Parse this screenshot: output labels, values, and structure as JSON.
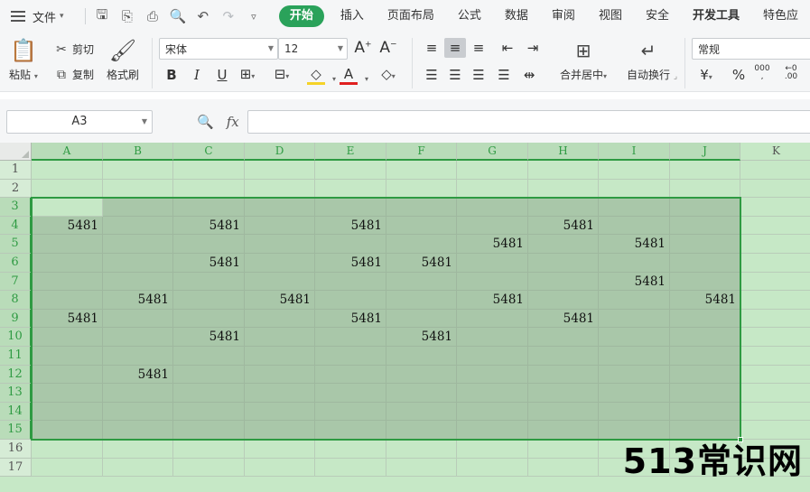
{
  "menubar": {
    "file_label": "文件",
    "tabs": [
      "开始",
      "插入",
      "页面布局",
      "公式",
      "数据",
      "审阅",
      "视图",
      "安全",
      "开发工具",
      "特色应"
    ],
    "active_tab": "开始"
  },
  "ribbon": {
    "paste_label": "粘贴",
    "cut_label": "剪切",
    "copy_label": "复制",
    "format_painter_label": "格式刷",
    "font_name": "宋体",
    "font_size": "12",
    "merge_center_label": "合并居中",
    "wrap_text_label": "自动换行",
    "number_format": "常规"
  },
  "formula_bar": {
    "name_box": "A3",
    "fx_label": "fx",
    "formula": ""
  },
  "sheet": {
    "columns": [
      "A",
      "B",
      "C",
      "D",
      "E",
      "F",
      "G",
      "H",
      "I",
      "J",
      "K"
    ],
    "rows": [
      "1",
      "2",
      "3",
      "4",
      "5",
      "6",
      "7",
      "8",
      "9",
      "10",
      "11",
      "12",
      "13",
      "14",
      "15",
      "16",
      "17"
    ],
    "cells": {
      "4": {
        "A": "5481",
        "C": "5481",
        "E": "5481",
        "H": "5481"
      },
      "5": {
        "G": "5481",
        "I": "5481"
      },
      "6": {
        "C": "5481",
        "E": "5481",
        "F": "5481"
      },
      "7": {
        "I": "5481"
      },
      "8": {
        "B": "5481",
        "D": "5481",
        "G": "5481",
        "J": "5481"
      },
      "9": {
        "A": "5481",
        "E": "5481",
        "H": "5481"
      },
      "10": {
        "C": "5481",
        "F": "5481"
      },
      "12": {
        "B": "5481"
      }
    },
    "selection": "A3:J15",
    "active_cell": "A3"
  },
  "watermark": "513常识网"
}
